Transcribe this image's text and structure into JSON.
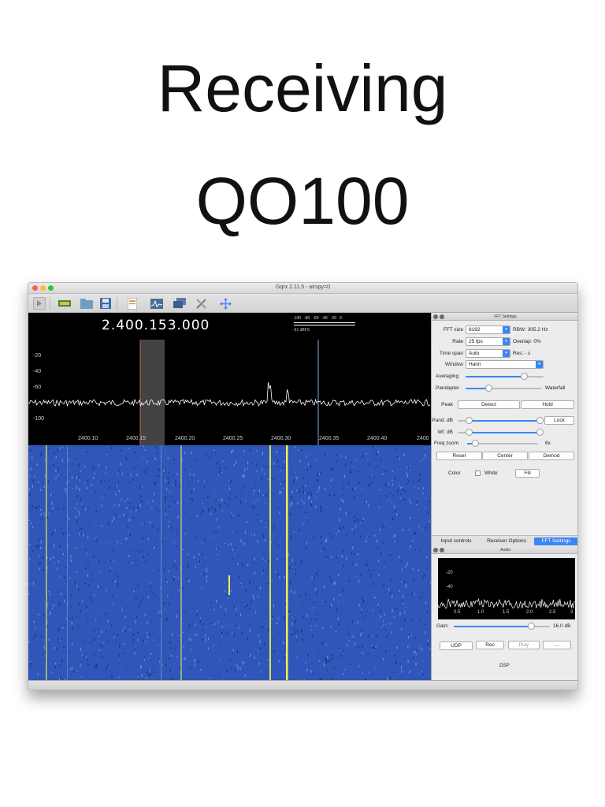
{
  "slide": {
    "title_line1": "Receiving",
    "title_line2": "QO100"
  },
  "window": {
    "title": "Gqrx 2.11.5 - airspy=0"
  },
  "toolbar": {
    "icons": [
      "play-icon",
      "device-icon",
      "open-folder-icon",
      "save-icon",
      "document-icon",
      "fft-icon",
      "monitor-icon",
      "tools-icon",
      "move-icon"
    ]
  },
  "spectrum": {
    "frequency": "2.400.153.000",
    "meter_ticks": [
      "-100",
      "-80",
      "-60",
      "-40",
      "-20",
      "0"
    ],
    "meter_level": "-61 dBFS",
    "y_labels": [
      "-20",
      "-40",
      "-60",
      "-100"
    ],
    "x_labels": [
      "2400.10",
      "2400.15",
      "2400.20",
      "2400.25",
      "2400.30",
      "2400.35",
      "2400.40",
      "2400"
    ]
  },
  "fft_panel": {
    "title": "FFT Settings",
    "fft_size_label": "FFT size",
    "fft_size": "8192",
    "rbw": "RBW: 305.2 Hz",
    "rate_label": "Rate",
    "rate": "25 fps",
    "overlap": "Overlap: 0%",
    "timespan_label": "Time span",
    "timespan": "Auto",
    "res": "Res: - s",
    "window_label": "Window",
    "window": "Hann",
    "averaging_label": "Averaging",
    "averaging_level": 0.75,
    "pandapter_label": "Pandapter",
    "waterfall_label": "Waterfall",
    "pandapter_split": 0.3,
    "peak_label": "Peak",
    "detect_btn": "Detect",
    "hold_btn": "Hold",
    "pand_db_label": "Pand. dB",
    "lock_btn": "Lock",
    "wf_db_label": "Wf. dB",
    "freq_zoom_label": "Freq zoom",
    "freq_zoom_value": "6x",
    "reset_btn": "Reset",
    "center_btn": "Center",
    "demod_btn": "Demod",
    "color_label": "Color",
    "white_label": "White",
    "fill_btn": "Fill"
  },
  "tabs": [
    "Input controls",
    "Receiver Options",
    "FFT Settings"
  ],
  "audio_panel": {
    "title": "Audio",
    "y_labels": [
      "-20",
      "-40"
    ],
    "x_labels": [
      "0.5",
      "1.0",
      "1.5",
      "2.0",
      "2.5",
      "3"
    ],
    "gain_label": "Gain:",
    "gain_value": "16.0 dB",
    "gain_level": 0.8,
    "udp_btn": "UDP",
    "rec_btn": "Rec",
    "play_btn": "Play",
    "more_btn": "...",
    "dsp_label": "DSP"
  },
  "colors": {
    "accent": "#3a86f5",
    "waterfall": "#2f56b8",
    "trace": "#ffffff",
    "signal": "#e6f04a"
  }
}
